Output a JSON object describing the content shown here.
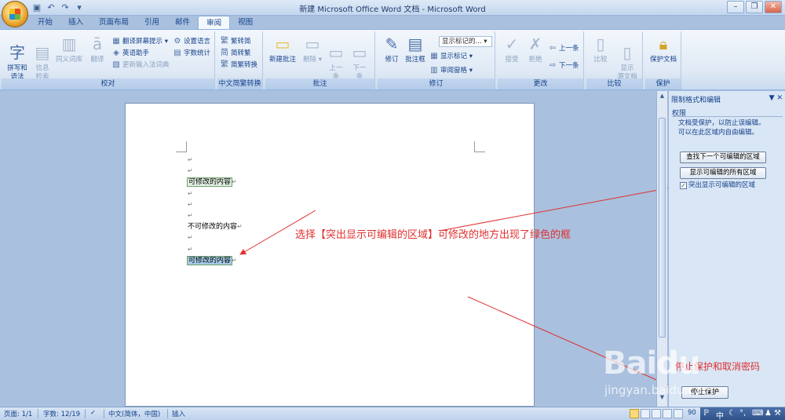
{
  "window": {
    "title": "新建 Microsoft Office Word 文档 - Microsoft Word"
  },
  "quick_access": {
    "icons": [
      "save-icon",
      "undo-icon",
      "redo-icon",
      "customize-icon"
    ]
  },
  "tabs": [
    "开始",
    "插入",
    "页面布局",
    "引用",
    "邮件",
    "审阅",
    "视图"
  ],
  "active_tab": "审阅",
  "ribbon": {
    "proofing": {
      "label": "校对",
      "spelling": "拼写和\n语法",
      "research": "信息\n检索",
      "thesaurus": "同义词库",
      "translate": "翻译",
      "translate_tip": "翻译屏幕提示",
      "english_assistant": "英语助手",
      "update_ime": "更新输入法词典",
      "set_language": "设置语言",
      "word_count": "字数统计"
    },
    "chinese": {
      "label": "中文简繁转换",
      "to_simplified": "繁转简",
      "to_traditional": "简转繁",
      "convert": "简繁转换"
    },
    "comments": {
      "label": "批注",
      "new": "新建批注",
      "delete": "删除",
      "prev": "上一\n条",
      "next": "下一\n条"
    },
    "tracking": {
      "label": "修订",
      "track": "修订",
      "balloons": "批注框",
      "display_combo": "显示标记的...",
      "show_markup": "显示标记",
      "review_pane": "审阅窗格"
    },
    "changes": {
      "label": "更改",
      "accept": "接受",
      "reject": "拒绝",
      "previous": "上一条",
      "next": "下一条"
    },
    "compare": {
      "label": "比较",
      "compare": "比较",
      "show_source": "显示\n源文档"
    },
    "protect": {
      "label": "保护",
      "protect_doc": "保护文档"
    }
  },
  "document": {
    "lines": [
      {
        "text": "",
        "type": "empty"
      },
      {
        "text": "",
        "type": "empty"
      },
      {
        "text": "可修改的内容",
        "type": "editable"
      },
      {
        "text": "",
        "type": "empty"
      },
      {
        "text": "",
        "type": "empty"
      },
      {
        "text": "",
        "type": "empty"
      },
      {
        "text": "不可修改的内容",
        "type": "normal"
      },
      {
        "text": "",
        "type": "empty"
      },
      {
        "text": "",
        "type": "empty"
      },
      {
        "text": "可修改的内容",
        "type": "editable"
      }
    ],
    "para_mark": "↵"
  },
  "annotations": {
    "main": "选择【突出显示可编辑的区域】可修改的地方出现了绿色的框",
    "secondary": "停止保护和取消密码"
  },
  "task_pane": {
    "title": "限制格式和编辑",
    "section": "权限",
    "description": "文档受保护，以防止误编辑。\n可以在此区域内自由编辑。",
    "find_next": "查找下一个可编辑的区域",
    "show_all": "显示可编辑的所有区域",
    "highlight_checkbox": "突出显示可编辑的区域",
    "highlight_checked": true,
    "stop_protection": "停止保护"
  },
  "watermark": {
    "brand": "Baidu",
    "sub": "jingyan.baidu.com"
  },
  "status_bar": {
    "page": "页面: 1/1",
    "words": "字数: 12/19",
    "language": "中文(简体，中国)",
    "mode": "插入",
    "zoom": "90"
  },
  "colors": {
    "annotation": "#e03030",
    "editable_bg": "#dfeedf",
    "editable_border": "#6fa36f",
    "ribbon": "#dfe9f5"
  }
}
